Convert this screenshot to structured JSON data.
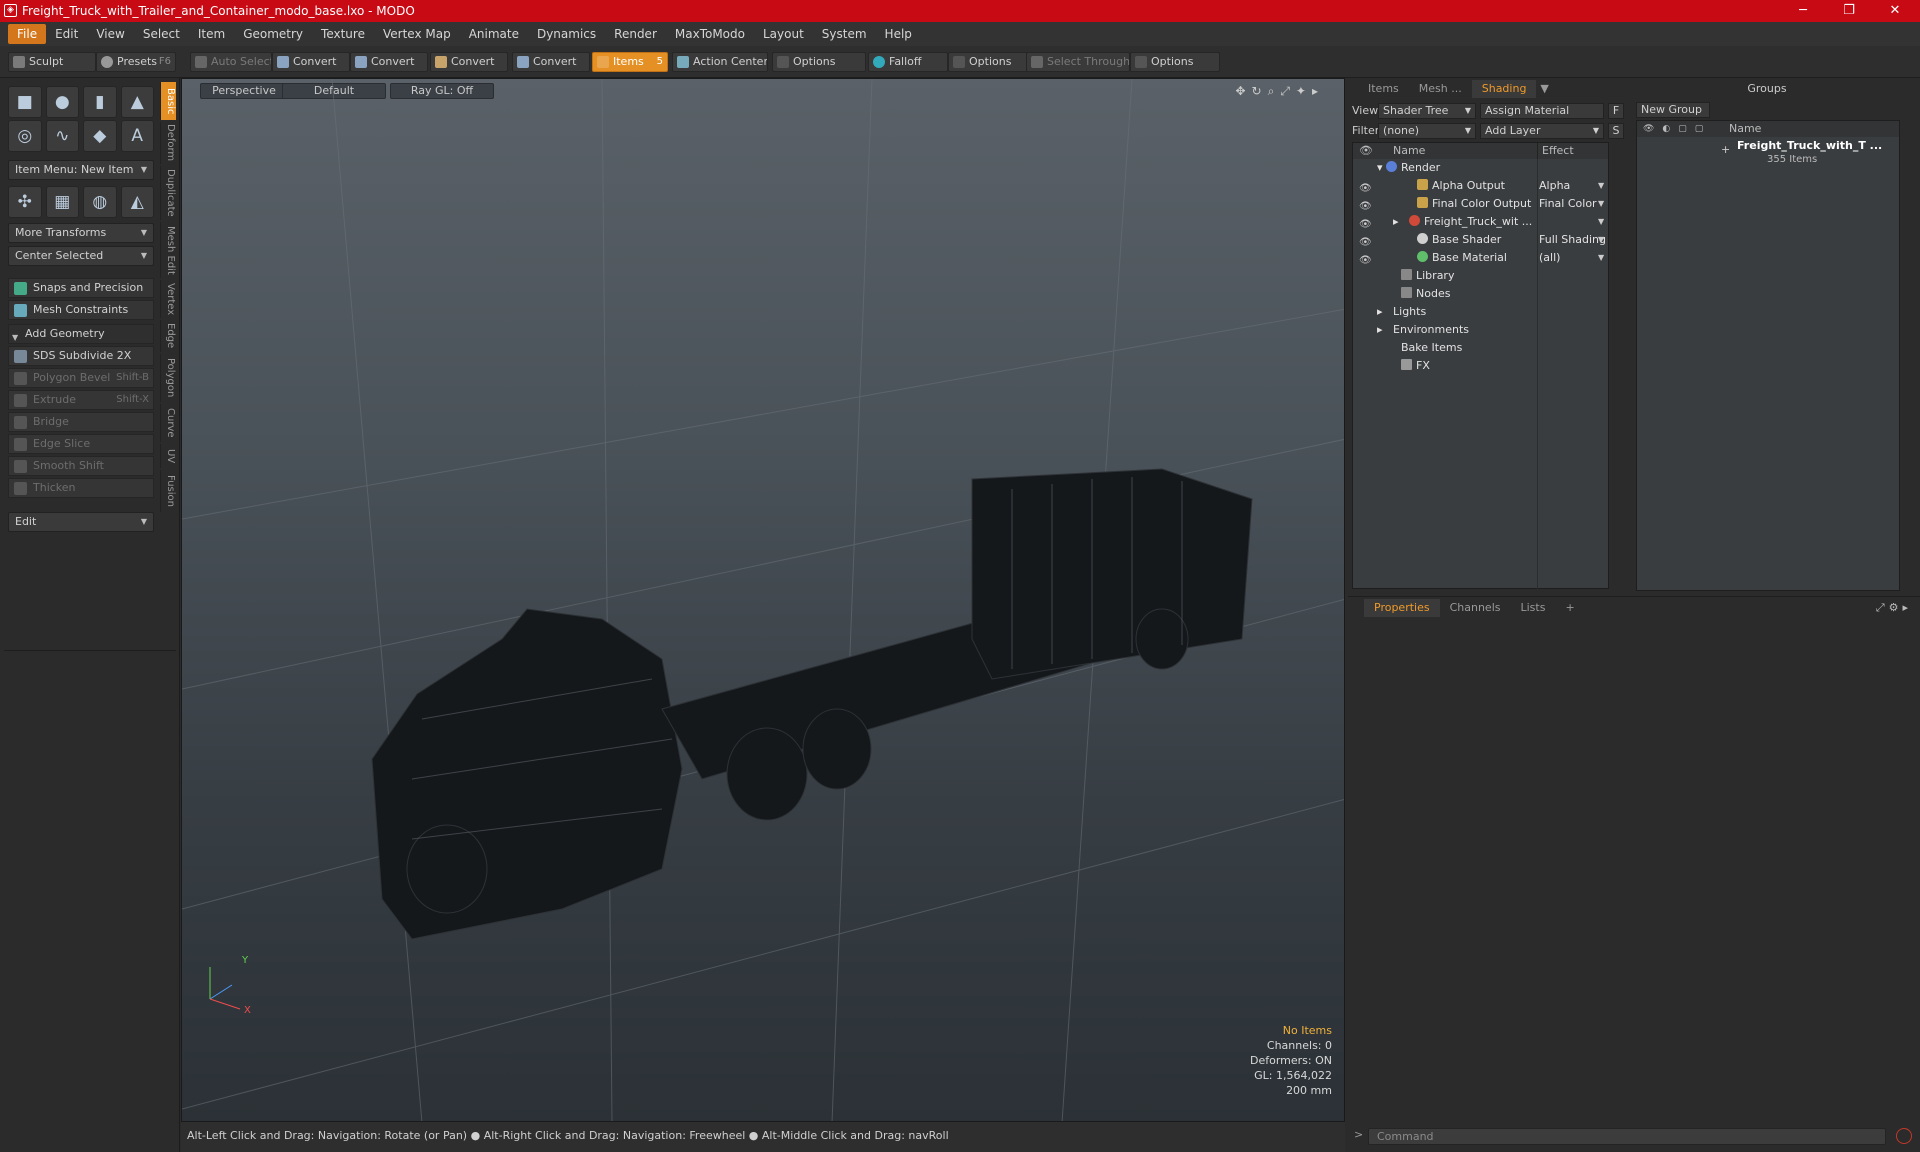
{
  "window": {
    "title": "Freight_Truck_with_Trailer_and_Container_modo_base.lxo - MODO"
  },
  "menu": [
    "File",
    "Edit",
    "View",
    "Select",
    "Item",
    "Geometry",
    "Texture",
    "Vertex Map",
    "Animate",
    "Dynamics",
    "Render",
    "MaxToModo",
    "Layout",
    "System",
    "Help"
  ],
  "toolbar": {
    "sculpt": "Sculpt",
    "presets": "Presets",
    "presets_key": "F6",
    "auto_select": "Auto Select",
    "convert1": "Convert",
    "convert2": "Convert",
    "convert3": "Convert",
    "convert4": "Convert",
    "items": "Items",
    "items_count": "5",
    "action_center": "Action Center",
    "options1": "Options",
    "falloff": "Falloff",
    "options2": "Options",
    "select_through": "Select Through",
    "options3": "Options"
  },
  "left": {
    "item_menu": "Item Menu: New Item",
    "more_transforms": "More Transforms",
    "center_selected": "Center Selected",
    "snaps": "Snaps and Precision",
    "mesh_constraints": "Mesh Constraints",
    "add_geometry": "Add Geometry",
    "sds": "SDS Subdivide 2X",
    "polygon_bevel": "Polygon Bevel",
    "polygon_bevel_key": "Shift-B",
    "extrude": "Extrude",
    "extrude_key": "Shift-X",
    "bridge": "Bridge",
    "edge_slice": "Edge Slice",
    "smooth_shift": "Smooth Shift",
    "thicken": "Thicken",
    "edit": "Edit",
    "vtabs": [
      "Basic",
      "Deform",
      "Duplicate",
      "Mesh Edit",
      "Vertex",
      "Edge",
      "Polygon",
      "Curve",
      "UV",
      "Fusion"
    ]
  },
  "viewport": {
    "perspective": "Perspective",
    "default": "Default",
    "raygl": "Ray GL: Off",
    "no_items": "No Items",
    "channels": "Channels: 0",
    "deformers": "Deformers: ON",
    "gl": "GL: 1,564,022",
    "scale": "200 mm"
  },
  "status": {
    "hint1": "Alt-Left Click and Drag: Navigation: Rotate (or Pan)",
    "hint2": "Alt-Right Click and Drag: Navigation: Freewheel",
    "hint3": "Alt-Middle Click and Drag: navRoll"
  },
  "shading": {
    "tabs": [
      "Items",
      "Mesh ...",
      "Shading"
    ],
    "view_label": "View",
    "view_value": "Shader Tree",
    "assign_material": "Assign Material",
    "f_btn": "F",
    "filter_label": "Filter",
    "filter_value": "(none)",
    "add_layer": "Add Layer",
    "s_btn": "S",
    "col_name": "Name",
    "col_effect": "Effect",
    "rows": [
      {
        "name": "Render",
        "effect": ""
      },
      {
        "name": "Alpha Output",
        "effect": "Alpha"
      },
      {
        "name": "Final Color Output",
        "effect": "Final Color"
      },
      {
        "name": "Freight_Truck_wit ...",
        "effect": ""
      },
      {
        "name": "Base Shader",
        "effect": "Full Shading"
      },
      {
        "name": "Base Material",
        "effect": "(all)"
      },
      {
        "name": "Library",
        "effect": ""
      },
      {
        "name": "Nodes",
        "effect": ""
      },
      {
        "name": "Lights",
        "effect": ""
      },
      {
        "name": "Environments",
        "effect": ""
      },
      {
        "name": "Bake Items",
        "effect": ""
      },
      {
        "name": "FX",
        "effect": ""
      }
    ]
  },
  "groups": {
    "title": "Groups",
    "new_group": "New Group",
    "col_name": "Name",
    "item_name": "Freight_Truck_with_T ...",
    "item_count": "355 Items"
  },
  "props": {
    "tabs": [
      "Properties",
      "Channels",
      "Lists"
    ],
    "plus": "+"
  },
  "command": {
    "placeholder": "Command"
  },
  "colors": {
    "title_red": "#c80a15",
    "accent": "#e59024",
    "tab_orange": "#f09a2a"
  }
}
